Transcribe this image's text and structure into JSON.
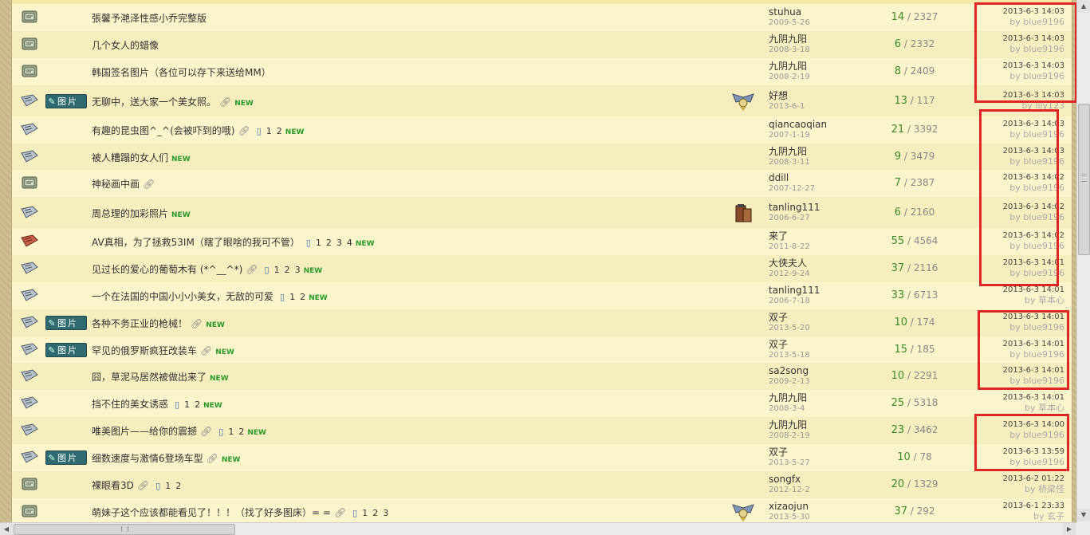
{
  "badge_label": "图片",
  "rows": [
    {
      "title": "張馨予滟泽性感小乔完整版",
      "clip": false,
      "pages": [],
      "new": false,
      "badge": false,
      "avatar": "",
      "author": "stuhua",
      "author_date": "2009-5-26",
      "replies": "14",
      "views": "2327",
      "last_time": "2013-6-3 14:03",
      "last_by": "blue9196",
      "folder": "scroll-icon"
    },
    {
      "title": "几个女人的蜡像",
      "clip": false,
      "pages": [],
      "new": false,
      "badge": false,
      "avatar": "",
      "author": "九阴九阳",
      "author_date": "2008-3-18",
      "replies": "6",
      "views": "2332",
      "last_time": "2013-6-3 14:03",
      "last_by": "blue9196",
      "folder": "scroll-icon"
    },
    {
      "title": "韩国签名图片（各位可以存下来送给MM）",
      "clip": false,
      "pages": [],
      "new": false,
      "badge": false,
      "avatar": "",
      "author": "九阴九阳",
      "author_date": "2008-2-19",
      "replies": "8",
      "views": "2409",
      "last_time": "2013-6-3 14:03",
      "last_by": "blue9196",
      "folder": "scroll-icon"
    },
    {
      "title": "无聊中，送大家一个美女照。",
      "clip": true,
      "pages": [],
      "new": true,
      "badge": true,
      "avatar": "wings-avatar",
      "author": "好想",
      "author_date": "2013-6-1",
      "replies": "13",
      "views": "117",
      "last_time": "2013-6-3 14:03",
      "last_by": "lily123",
      "folder": "paper-icon"
    },
    {
      "title": "有趣的昆虫图^_^(会被吓到的哦)",
      "clip": true,
      "pages": [
        "1",
        "2"
      ],
      "new": true,
      "badge": false,
      "avatar": "",
      "author": "qiancaoqian",
      "author_date": "2007-1-19",
      "replies": "21",
      "views": "3392",
      "last_time": "2013-6-3 14:03",
      "last_by": "blue9196",
      "folder": "paper-icon"
    },
    {
      "title": "被人糟蹋的女人们",
      "clip": false,
      "pages": [],
      "new": true,
      "badge": false,
      "avatar": "",
      "author": "九阴九阳",
      "author_date": "2008-3-11",
      "replies": "9",
      "views": "3479",
      "last_time": "2013-6-3 14:03",
      "last_by": "blue9196",
      "folder": "paper-icon"
    },
    {
      "title": "神秘画中画",
      "clip": true,
      "pages": [],
      "new": false,
      "badge": false,
      "avatar": "",
      "author": "ddill",
      "author_date": "2007-12-27",
      "replies": "7",
      "views": "2387",
      "last_time": "2013-6-3 14:02",
      "last_by": "blue9196",
      "folder": "scroll-icon"
    },
    {
      "title": "周总理的加彩照片",
      "clip": false,
      "pages": [],
      "new": true,
      "badge": false,
      "avatar": "book-avatar",
      "author": "tanling111",
      "author_date": "2006-6-27",
      "replies": "6",
      "views": "2160",
      "last_time": "2013-6-3 14:02",
      "last_by": "blue9196",
      "folder": "paper-icon"
    },
    {
      "title": "AV真相，为了拯救53IM（瞎了眼啥的我可不管）",
      "clip": false,
      "pages": [
        "1",
        "2",
        "3",
        "4"
      ],
      "new": true,
      "badge": false,
      "avatar": "",
      "author": "来了",
      "author_date": "2011-8-22",
      "replies": "55",
      "views": "4564",
      "last_time": "2013-6-3 14:02",
      "last_by": "blue9196",
      "folder": "hot-icon"
    },
    {
      "title": "见过长的爱心的葡萄木有 (*^__^*)",
      "clip": true,
      "pages": [
        "1",
        "2",
        "3"
      ],
      "new": true,
      "badge": false,
      "avatar": "",
      "author": "大侠夫人",
      "author_date": "2012-9-24",
      "replies": "37",
      "views": "2116",
      "last_time": "2013-6-3 14:01",
      "last_by": "blue9196",
      "folder": "paper-icon"
    },
    {
      "title": "一个在法国的中国小小小美女，无敌的可爱",
      "clip": false,
      "pages": [
        "1",
        "2"
      ],
      "new": true,
      "badge": false,
      "avatar": "",
      "author": "tanling111",
      "author_date": "2006-7-18",
      "replies": "33",
      "views": "6713",
      "last_time": "2013-6-3 14:01",
      "last_by": "草本心",
      "folder": "paper-icon"
    },
    {
      "title": "各种不务正业的枪械！",
      "clip": true,
      "pages": [],
      "new": true,
      "badge": true,
      "avatar": "",
      "author": "双子",
      "author_date": "2013-5-20",
      "replies": "10",
      "views": "174",
      "last_time": "2013-6-3 14:01",
      "last_by": "blue9196",
      "folder": "paper-icon"
    },
    {
      "title": "罕见的俄罗斯疯狂改装车",
      "clip": true,
      "pages": [],
      "new": true,
      "badge": true,
      "avatar": "",
      "author": "双子",
      "author_date": "2013-5-18",
      "replies": "15",
      "views": "185",
      "last_time": "2013-6-3 14:01",
      "last_by": "blue9196",
      "folder": "paper-icon"
    },
    {
      "title": "囧，草泥马居然被做出来了",
      "clip": false,
      "pages": [],
      "new": true,
      "badge": false,
      "avatar": "",
      "author": "sa2song",
      "author_date": "2009-2-13",
      "replies": "10",
      "views": "2291",
      "last_time": "2013-6-3 14:01",
      "last_by": "blue9196",
      "folder": "paper-icon"
    },
    {
      "title": "挡不住的美女诱惑",
      "clip": false,
      "pages": [
        "1",
        "2"
      ],
      "new": true,
      "badge": false,
      "avatar": "",
      "author": "九阴九阳",
      "author_date": "2008-3-4",
      "replies": "25",
      "views": "5318",
      "last_time": "2013-6-3 14:01",
      "last_by": "草本心",
      "folder": "paper-icon"
    },
    {
      "title": "唯美图片——给你的震撼",
      "clip": true,
      "pages": [
        "1",
        "2"
      ],
      "new": true,
      "badge": false,
      "avatar": "",
      "author": "九阴九阳",
      "author_date": "2008-2-19",
      "replies": "23",
      "views": "3462",
      "last_time": "2013-6-3 14:00",
      "last_by": "blue9196",
      "folder": "paper-icon"
    },
    {
      "title": "细数速度与激情6登场车型",
      "clip": true,
      "pages": [],
      "new": true,
      "badge": true,
      "avatar": "",
      "author": "双子",
      "author_date": "2013-5-27",
      "replies": "10",
      "views": "78",
      "last_time": "2013-6-3 13:59",
      "last_by": "blue9196",
      "folder": "paper-icon"
    },
    {
      "title": "裸眼看3D",
      "clip": true,
      "pages": [
        "1",
        "2"
      ],
      "new": false,
      "badge": false,
      "avatar": "",
      "author": "songfx",
      "author_date": "2012-12-2",
      "replies": "20",
      "views": "1329",
      "last_time": "2013-6-2 01:22",
      "last_by": "桥梁怪",
      "folder": "scroll-icon"
    },
    {
      "title": "萌妹子这个应该都能看见了！！！（找了好多图床）= =",
      "clip": true,
      "pages": [
        "1",
        "2",
        "3"
      ],
      "new": false,
      "badge": false,
      "avatar": "wings-avatar",
      "author": "xizaojun",
      "author_date": "2013-5-30",
      "replies": "37",
      "views": "292",
      "last_time": "2013-6-1 23:33",
      "last_by": "玄子",
      "folder": "scroll-icon"
    }
  ],
  "new_label": "NEW",
  "by_prefix": "by",
  "highlight_color": "#e02525",
  "reply_color": "#3a8a2a",
  "new_color": "#2a9a2a"
}
